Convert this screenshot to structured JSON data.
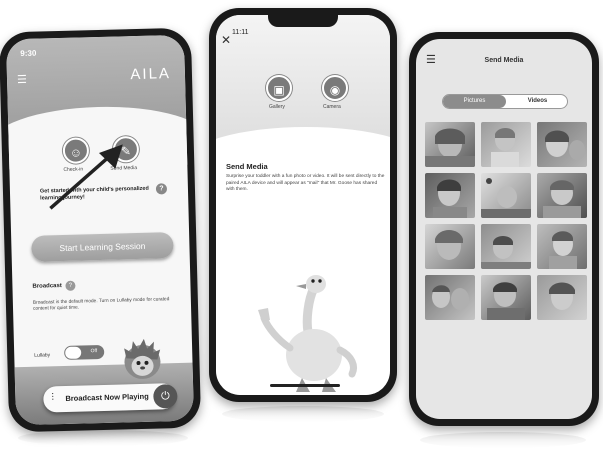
{
  "screen1": {
    "time": "9:30",
    "menu_icon": "hamburger-icon",
    "logo_text": "AILA",
    "checkin_label": "Check-in",
    "checkin_icon": "child-icon",
    "send_media_label": "Send Media",
    "send_media_icon": "media-icon",
    "intro_text": "Get started with your child's personalized learning journey!",
    "help_icon": "help-icon",
    "start_button_label": "Start Learning Session",
    "broadcast_heading": "Broadcast",
    "broadcast_description": "Broadcast is the default mode. Turn on Lullaby mode for curated content for quiet time.",
    "lullaby_label": "Lullaby",
    "lullaby_toggle_label": "Off",
    "broadcast_bar_label": "Broadcast Now Playing",
    "power_icon": "power-icon"
  },
  "screen2": {
    "time": "11:11",
    "close_icon": "close-icon",
    "gallery_label": "Gallery",
    "camera_label": "Camera",
    "title": "Send Media",
    "description": "Surprise your toddler with a fun photo or video. It will be sent directly to the paired AILA device and will appear as \"mail\" that Mr. Goose has shared with them."
  },
  "screen3": {
    "menu_icon": "hamburger-icon",
    "title": "Send Media",
    "tabs": [
      {
        "label": "Pictures",
        "active": true
      },
      {
        "label": "Videos",
        "active": false
      }
    ],
    "thumbnail_count": 12
  }
}
